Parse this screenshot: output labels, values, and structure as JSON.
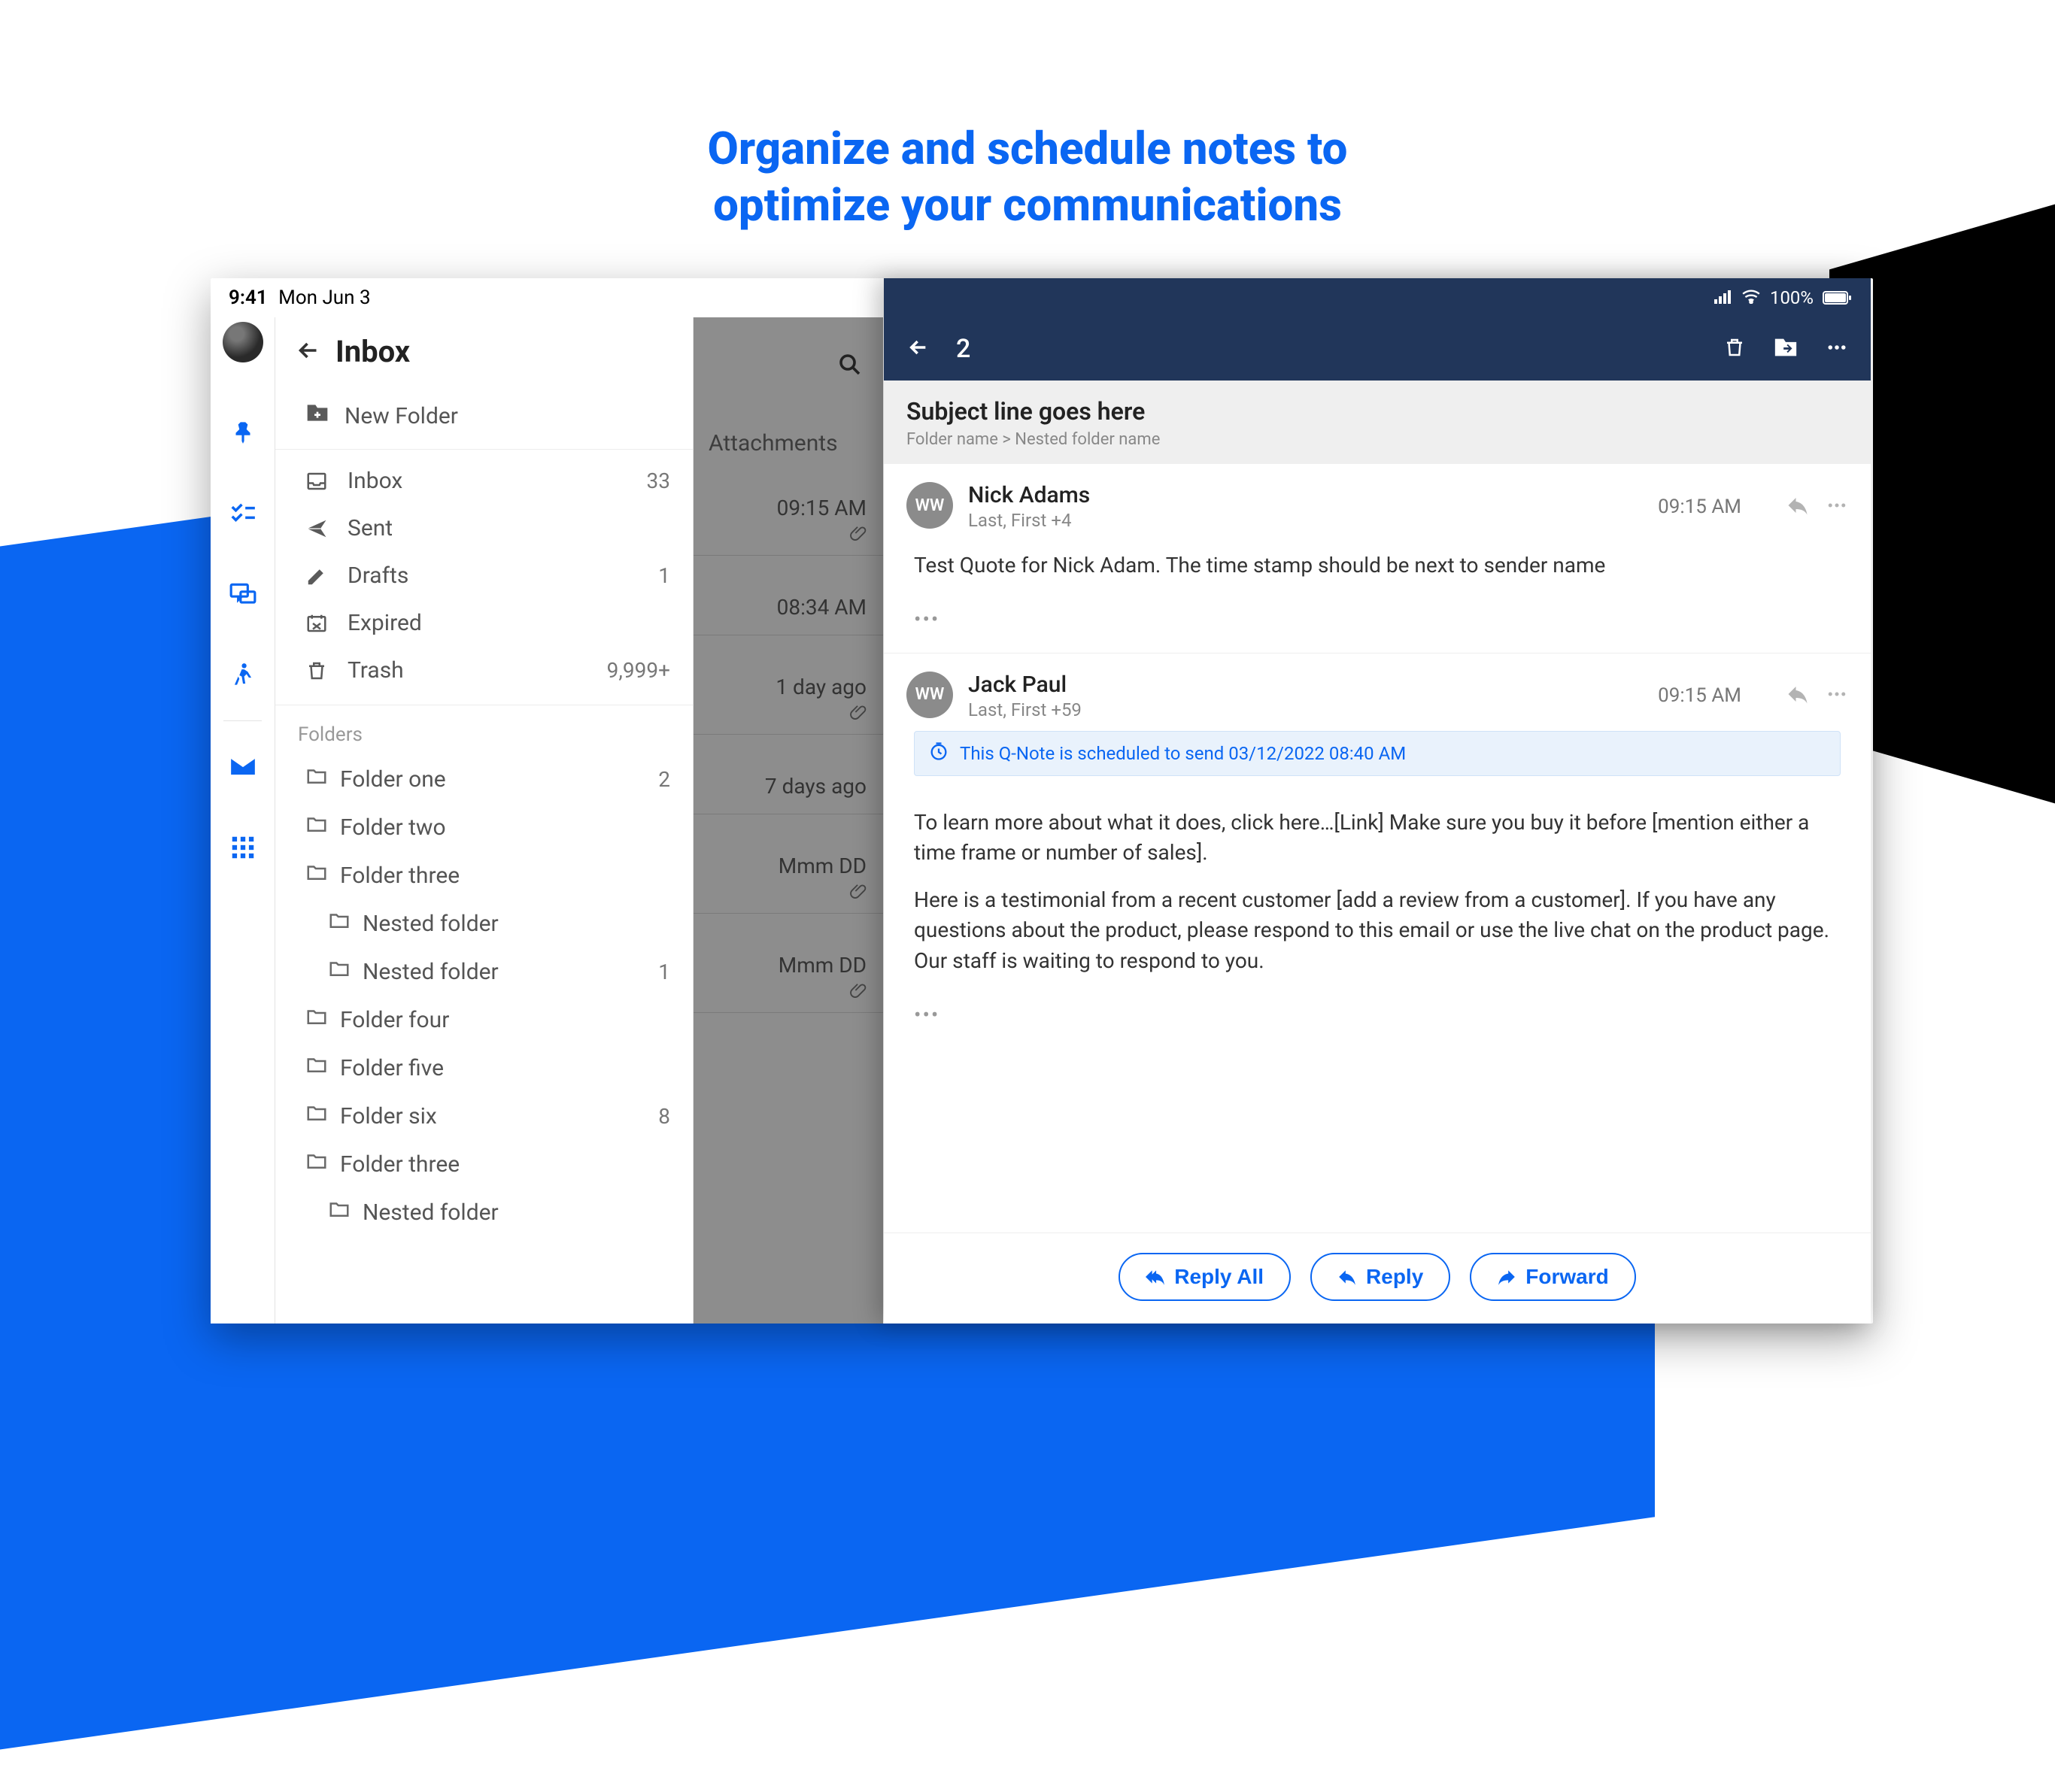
{
  "promo": {
    "title_line1": "Organize and schedule notes to",
    "title_line2": "optimize your communications"
  },
  "status": {
    "time": "9:41",
    "date": "Mon Jun 3"
  },
  "sidebar": {
    "title": "Inbox",
    "new_folder_label": "New Folder",
    "system_folders": [
      {
        "label": "Inbox",
        "count": "33",
        "icon": "inbox"
      },
      {
        "label": "Sent",
        "count": "",
        "icon": "sent"
      },
      {
        "label": "Drafts",
        "count": "1",
        "icon": "drafts"
      },
      {
        "label": "Expired",
        "count": "",
        "icon": "expired"
      },
      {
        "label": "Trash",
        "count": "9,999+",
        "icon": "trash"
      }
    ],
    "folders_heading": "Folders",
    "user_folders": [
      {
        "label": "Folder one",
        "count": "2",
        "nested": false
      },
      {
        "label": "Folder two",
        "count": "",
        "nested": false
      },
      {
        "label": "Folder three",
        "count": "",
        "nested": false
      },
      {
        "label": "Nested folder",
        "count": "",
        "nested": true
      },
      {
        "label": "Nested folder",
        "count": "1",
        "nested": true
      },
      {
        "label": "Folder four",
        "count": "",
        "nested": false
      },
      {
        "label": "Folder five",
        "count": "",
        "nested": false
      },
      {
        "label": "Folder six",
        "count": "8",
        "nested": false
      },
      {
        "label": "Folder three",
        "count": "",
        "nested": false
      },
      {
        "label": "Nested folder",
        "count": "",
        "nested": true
      }
    ]
  },
  "mid": {
    "attachments_label": "Attachments",
    "items": [
      {
        "time": "09:15 AM",
        "has_attach": true
      },
      {
        "time": "08:34 AM",
        "has_attach": false
      },
      {
        "time": "1 day ago",
        "has_attach": true
      },
      {
        "time": "7 days ago",
        "has_attach": false
      },
      {
        "time": "Mmm DD",
        "has_attach": true
      },
      {
        "time": "Mmm DD",
        "has_attach": true
      }
    ]
  },
  "message_panel": {
    "status": {
      "battery": "100%"
    },
    "thread_count": "2",
    "subject": "Subject line goes here",
    "breadcrumb": "Folder name > Nested folder name",
    "messages": [
      {
        "avatar_initials": "WW",
        "sender": "Nick Adams",
        "recipients": "Last, First  +4",
        "time": "09:15 AM",
        "body": "Test Quote for Nick Adam. The time stamp should be next to sender name",
        "scheduled": null
      },
      {
        "avatar_initials": "WW",
        "sender": "Jack Paul",
        "recipients": "Last, First  +59",
        "time": "09:15 AM",
        "scheduled": "This Q-Note is scheduled to send 03/12/2022 08:40 AM",
        "body_p1": "To learn more about what it does, click here…[Link] Make sure you buy it before [mention either a time frame or number of sales].",
        "body_p2": "Here is a testimonial from a recent customer [add a review from a customer]. If you have any questions about the product, please respond to this email or use the live chat on the product page. Our staff is waiting to respond to you."
      }
    ],
    "actions": {
      "reply_all": "Reply All",
      "reply": "Reply",
      "forward": "Forward"
    }
  }
}
